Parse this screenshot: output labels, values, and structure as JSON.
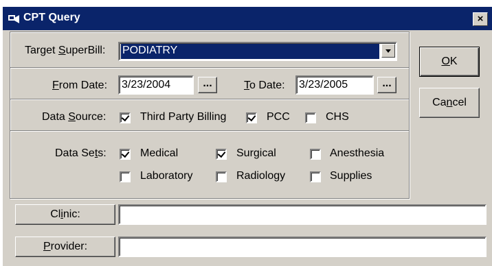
{
  "window": {
    "title": "CPT Query",
    "close_glyph": "×"
  },
  "superbill": {
    "label_pre": "Target ",
    "label_key": "S",
    "label_post": "uperBill:",
    "value": "PODIATRY"
  },
  "dates": {
    "from_label_key": "F",
    "from_label_post": "rom Date:",
    "from_value": "3/23/2004",
    "to_label_key": "T",
    "to_label_post": "o Date:",
    "to_value": "3/23/2005",
    "browse_label": "..."
  },
  "data_source": {
    "label_pre": "Data ",
    "label_key": "S",
    "label_post": "ource:",
    "options": [
      {
        "label": "Third Party Billing",
        "checked": true
      },
      {
        "label": "PCC",
        "checked": true
      },
      {
        "label": "CHS",
        "checked": false
      }
    ]
  },
  "data_sets": {
    "label_pre": "Data Se",
    "label_key": "t",
    "label_post": "s:",
    "options": [
      {
        "label": "Medical",
        "checked": true
      },
      {
        "label": "Surgical",
        "checked": true
      },
      {
        "label": "Anesthesia",
        "checked": false
      },
      {
        "label": "Laboratory",
        "checked": false
      },
      {
        "label": "Radiology",
        "checked": false
      },
      {
        "label": "Supplies",
        "checked": false
      }
    ]
  },
  "buttons": {
    "ok_key": "O",
    "ok_post": "K",
    "cancel_pre": "Ca",
    "cancel_key": "n",
    "cancel_post": "cel"
  },
  "clinic": {
    "label_pre": "Cl",
    "label_key": "i",
    "label_post": "nic:",
    "value": ""
  },
  "provider": {
    "label_key": "P",
    "label_post": "rovider:",
    "value": ""
  }
}
